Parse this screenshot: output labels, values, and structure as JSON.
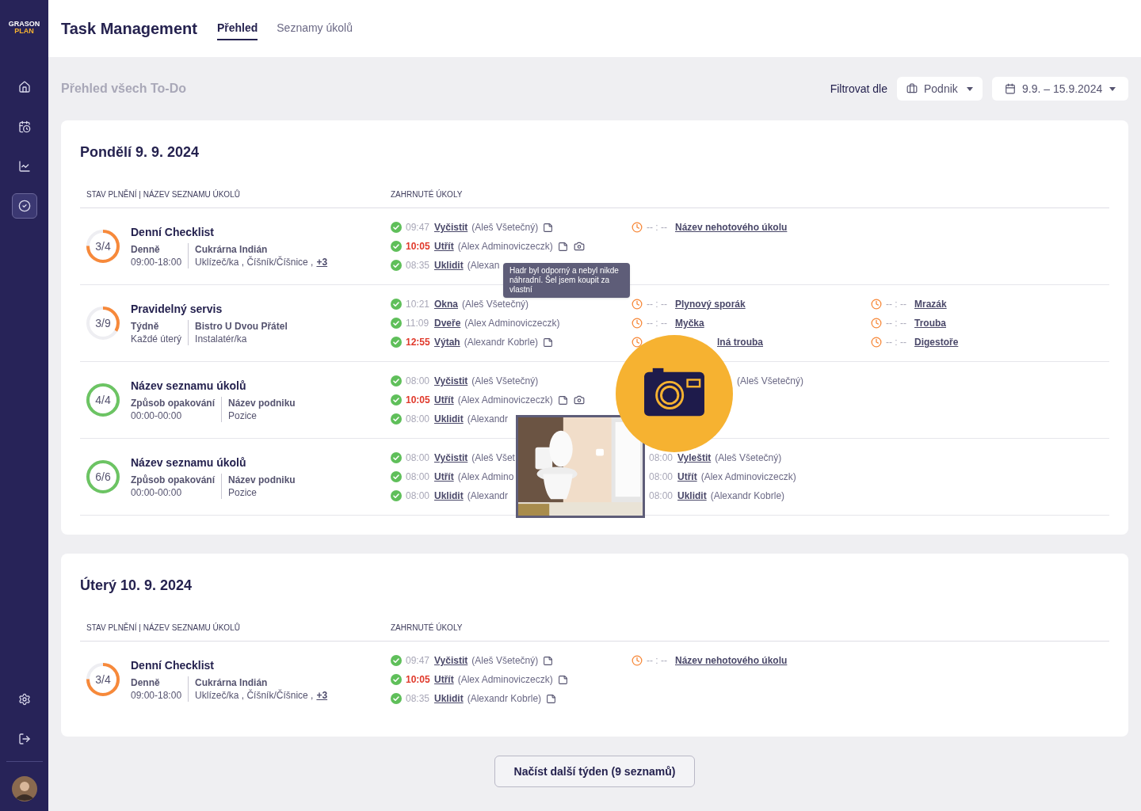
{
  "sidebar": {
    "logo": {
      "top": "GRASON",
      "bottom": "PLAN"
    },
    "nav": [
      {
        "selected": false
      },
      {
        "selected": false
      },
      {
        "selected": false
      },
      {
        "selected": true
      }
    ]
  },
  "header": {
    "title": "Task Management",
    "tabs": [
      {
        "label": "Přehled",
        "selected": true
      },
      {
        "label": "Seznamy úkolů",
        "selected": false
      }
    ]
  },
  "page": {
    "heading": "Přehled všech To-Do",
    "filter_label": "Filtrovat dle",
    "business_filter": "Podnik",
    "date_filter": "9.9. – 15.9.2024"
  },
  "days": [
    {
      "title": "Pondělí 9. 9. 2024",
      "columns": [
        "STAV PLNĚNÍ | NÁZEV SEZNAMU ÚKOLŮ",
        "ZAHRNUTÉ ÚKOLY"
      ],
      "rows": [
        {
          "progress": "3/4",
          "level": 0.75,
          "name": "Denní Checklist",
          "recurrence": "Denně",
          "hours": "09:00-18:00",
          "business": "Cukrárna Indián",
          "positions": "Uklízeč/ka , Číšník/Číšnice ,",
          "more": "+3",
          "task_columns": [
            [
              {
                "done": true,
                "time": "09:47",
                "late": false,
                "name": "Vyčistit",
                "person": "(Aleš Všetečný)",
                "note": true,
                "photo": false
              },
              {
                "done": true,
                "time": "10:05",
                "late": true,
                "name": "Utřít",
                "person": "(Alex Adminoviczeczk)",
                "note": true,
                "photo": true
              },
              {
                "done": true,
                "time": "08:35",
                "late": false,
                "name": "Uklidit",
                "person": "(Alexan",
                "note": false,
                "photo": false
              }
            ],
            [
              {
                "done": false,
                "time": "-- : --",
                "late": false,
                "name": "Název nehotového úkolu",
                "note": false,
                "photo": false
              }
            ],
            []
          ]
        },
        {
          "progress": "3/9",
          "level": 0.333,
          "name": "Pravidelný servis",
          "recurrence": "Týdně",
          "hours": "Každé úterý",
          "business": "Bistro U Dvou Přátel",
          "positions": "Instalatér/ka",
          "task_columns": [
            [
              {
                "done": true,
                "time": "10:21",
                "late": false,
                "name": "Okna",
                "person": "(Aleš Všetečný)",
                "note": false,
                "photo": false
              },
              {
                "done": true,
                "time": "11:09",
                "late": false,
                "name": "Dveře",
                "person": "(Alex Adminoviczeczk)",
                "note": false,
                "photo": false
              },
              {
                "done": true,
                "time": "12:55",
                "late": true,
                "name": "Výtah",
                "person": "(Alexandr Kobrle)",
                "note": true,
                "photo": false
              }
            ],
            [
              {
                "done": false,
                "time": "-- : --",
                "late": false,
                "name": "Plynový sporák",
                "note": false,
                "photo": false
              },
              {
                "done": false,
                "time": "-- : --",
                "late": false,
                "name": "Myčka",
                "note": false,
                "photo": false
              },
              {
                "done": false,
                "name": "lná trouba",
                "note": false,
                "photo": false
              }
            ],
            [
              {
                "done": false,
                "time": "-- : --",
                "late": false,
                "name": "Mrazák",
                "note": false,
                "photo": false
              },
              {
                "done": false,
                "time": "-- : --",
                "late": false,
                "name": "Trouba",
                "note": false,
                "photo": false
              },
              {
                "done": false,
                "time": "-- : --",
                "late": false,
                "name": "Digestoře",
                "note": false,
                "photo": false
              }
            ]
          ]
        },
        {
          "progress": "4/4",
          "level": 1,
          "name": "Název seznamu úkolů",
          "recurrence": "Způsob opakování",
          "hours": "00:00-00:00",
          "business": "Název podniku",
          "positions": "Pozice",
          "task_columns": [
            [
              {
                "done": true,
                "time": "08:00",
                "late": false,
                "name": "Vyčistit",
                "person": "(Aleš Všetečný)",
                "note": false,
                "photo": false
              },
              {
                "done": true,
                "time": "10:05",
                "late": true,
                "name": "Utřít",
                "person": "(Alex Adminoviczeczk)",
                "note": true,
                "photo": true
              },
              {
                "done": true,
                "time": "08:00",
                "late": false,
                "name": "Uklidit",
                "person": "(Alexandr",
                "note": false,
                "photo": false
              }
            ],
            [
              {
                "person": "(Aleš Všetečný)",
                "note": false,
                "photo": false
              }
            ],
            []
          ]
        },
        {
          "progress": "6/6",
          "level": 1,
          "name": "Název seznamu úkolů",
          "recurrence": "Způsob opakování",
          "hours": "00:00-00:00",
          "business": "Název podniku",
          "positions": "Pozice",
          "task_columns": [
            [
              {
                "done": true,
                "time": "08:00",
                "late": false,
                "name": "Vyčistit",
                "person": "(Aleš Všet",
                "note": false,
                "photo": false
              },
              {
                "done": true,
                "time": "08:00",
                "late": false,
                "name": "Utřít",
                "person": "(Alex Admino",
                "note": false,
                "photo": false
              },
              {
                "done": true,
                "time": "08:00",
                "late": false,
                "name": "Uklidit",
                "person": "(Alexandr",
                "note": false,
                "photo": false
              }
            ],
            [
              {
                "time": "08:00",
                "late": false,
                "name": "Vyleštit",
                "person": "(Aleš Všetečný)",
                "note": false,
                "photo": false
              },
              {
                "time": "08:00",
                "late": false,
                "name": "Utřít",
                "person": "(Alex Adminoviczeczk)",
                "note": false,
                "photo": false
              },
              {
                "time": "08:00",
                "late": false,
                "name": "Uklidit",
                "person": "(Alexandr Kobrle)",
                "note": false,
                "photo": false
              }
            ],
            []
          ]
        }
      ],
      "tooltip": "Hadr byl odporný a nebyl nikde náhradní. Šel jsem koupit za vlastní",
      "photo_preview": {
        "kind": "picture"
      },
      "camera_badge": true
    },
    {
      "title": "Úterý 10. 9. 2024",
      "columns": [
        "STAV PLNĚNÍ | NÁZEV SEZNAMU ÚKOLŮ",
        "ZAHRNUTÉ ÚKOLY"
      ],
      "rows": [
        {
          "progress": "3/4",
          "level": 0.75,
          "name": "Denní Checklist",
          "recurrence": "Denně",
          "hours": "09:00-18:00",
          "business": "Cukrárna Indián",
          "positions": "Uklízeč/ka , Číšník/Číšnice ,",
          "more": "+3",
          "task_columns": [
            [
              {
                "done": true,
                "time": "09:47",
                "late": false,
                "name": "Vyčistit",
                "person": "(Aleš Všetečný)",
                "note": true,
                "photo": false
              },
              {
                "done": true,
                "time": "10:05",
                "late": true,
                "name": "Utřít",
                "person": "(Alex Adminoviczeczk)",
                "note": true,
                "photo": false
              },
              {
                "done": true,
                "time": "08:35",
                "late": false,
                "name": "Uklidit",
                "person": "(Alexandr Kobrle)",
                "note": true,
                "photo": false
              }
            ],
            [
              {
                "done": false,
                "time": "-- : --",
                "late": false,
                "name": "Název nehotového úkolu",
                "note": false,
                "photo": false
              }
            ],
            []
          ]
        }
      ]
    }
  ],
  "load_more": "Načíst další týden (9 seznamů)"
}
